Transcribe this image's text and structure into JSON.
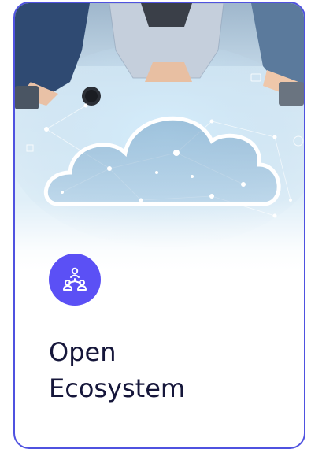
{
  "card": {
    "title_lines": [
      "Open",
      "Ecosystem"
    ],
    "icon": "network-people-icon",
    "accent_color": "#5b50f5",
    "border_color": "#4f52e0",
    "image": "people-at-table-cloud-network"
  }
}
